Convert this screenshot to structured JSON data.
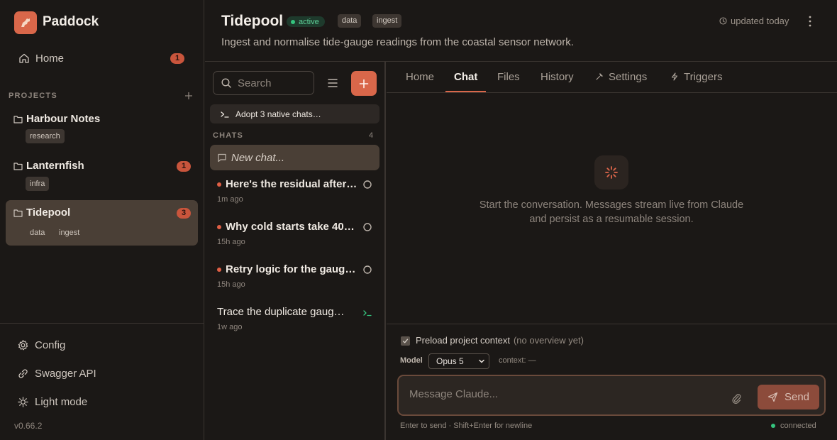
{
  "app": {
    "name": "Paddock",
    "version": "v0.66.2"
  },
  "sidebar": {
    "home_label": "Home",
    "home_badge": "1",
    "projects_label": "PROJECTS",
    "projects": [
      {
        "name": "Harbour Notes",
        "tags": [
          "research"
        ],
        "badge": ""
      },
      {
        "name": "Lanternfish",
        "tags": [
          "infra"
        ],
        "badge": "1"
      },
      {
        "name": "Tidepool",
        "tags": [
          "data",
          "ingest"
        ],
        "badge": "3",
        "active": true
      }
    ],
    "footer": {
      "config": "Config",
      "swagger": "Swagger API",
      "theme": "Light mode"
    }
  },
  "project": {
    "title": "Tidepool",
    "status": "active",
    "tags": [
      "data",
      "ingest"
    ],
    "description": "Ingest and normalise tide-gauge readings from the coastal sensor network.",
    "updated": "updated today"
  },
  "chatlist": {
    "search_placeholder": "Search",
    "adopt_label": "Adopt 3 native chats…",
    "chats_label": "CHATS",
    "chats_count": "4",
    "new_chat_label": "New chat...",
    "items": [
      {
        "title": "Here's the residual after…",
        "time": "1m ago",
        "unread": true,
        "status": "pending"
      },
      {
        "title": "Why cold starts take 40…",
        "time": "15h ago",
        "unread": true,
        "status": "pending"
      },
      {
        "title": "Retry logic for the gaug…",
        "time": "15h ago",
        "unread": true,
        "status": "pending"
      },
      {
        "title": "Trace the duplicate gaug…",
        "time": "1w ago",
        "unread": false,
        "status": "terminal"
      }
    ]
  },
  "tabs": [
    "Home",
    "Chat",
    "Files",
    "History",
    "Settings",
    "Triggers"
  ],
  "active_tab": "Chat",
  "chat": {
    "empty_line1": "Start the conversation. Messages stream live from Claude",
    "empty_line2": "and persist as a resumable session.",
    "preload_label": "Preload project context",
    "preload_sub": "(no overview yet)",
    "model_label": "Model",
    "model_value": "Opus 5",
    "context_label": "context: —",
    "composer_placeholder": "Message Claude...",
    "send_label": "Send",
    "hint": "Enter to send · Shift+Enter for newline",
    "connection": "connected"
  },
  "colors": {
    "accent": "#d9674a",
    "background": "#1b1816",
    "success": "#35c47e",
    "badge": "#c9553c"
  }
}
